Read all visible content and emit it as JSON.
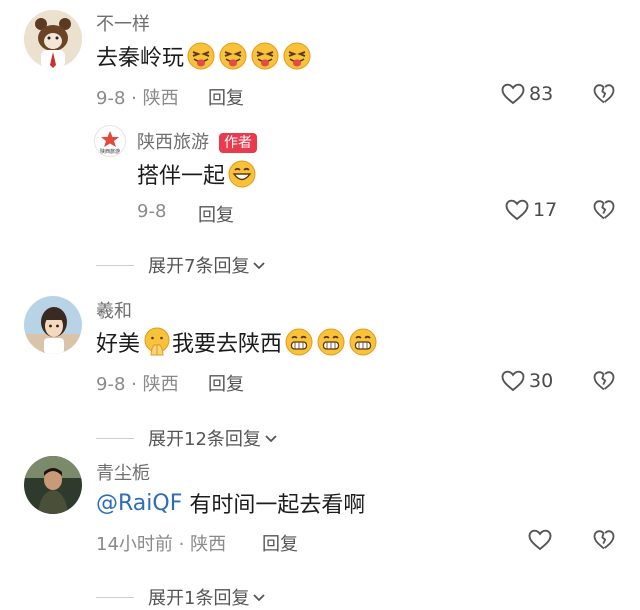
{
  "comments": [
    {
      "username": "不一样",
      "text": "去秦岭玩",
      "date_location": "9-8 · 陕西",
      "reply_label": "回复",
      "likes": "83"
    },
    {
      "username": "陕西旅游",
      "author_badge": "作者",
      "avatar_text": "陕西旅游",
      "text": "搭伴一起",
      "date_location": "9-8",
      "reply_label": "回复",
      "likes": "17"
    },
    {
      "username": "羲和",
      "text_a": "好美",
      "text_b": "我要去陕西",
      "date_location": "9-8 · 陕西",
      "reply_label": "回复",
      "likes": "30"
    },
    {
      "username": "青尘栀",
      "mention": "@RaiQF",
      "text": " 有时间一起去看啊",
      "date_location": "14小时前 · 陕西",
      "reply_label": "回复",
      "likes": ""
    }
  ],
  "expanders": [
    {
      "label": "展开7条回复"
    },
    {
      "label": "展开12条回复"
    },
    {
      "label": "展开1条回复"
    }
  ],
  "icons": {
    "like": "heart-outline-icon",
    "dislike": "broken-heart-icon",
    "expand": "chevron-down-icon"
  }
}
